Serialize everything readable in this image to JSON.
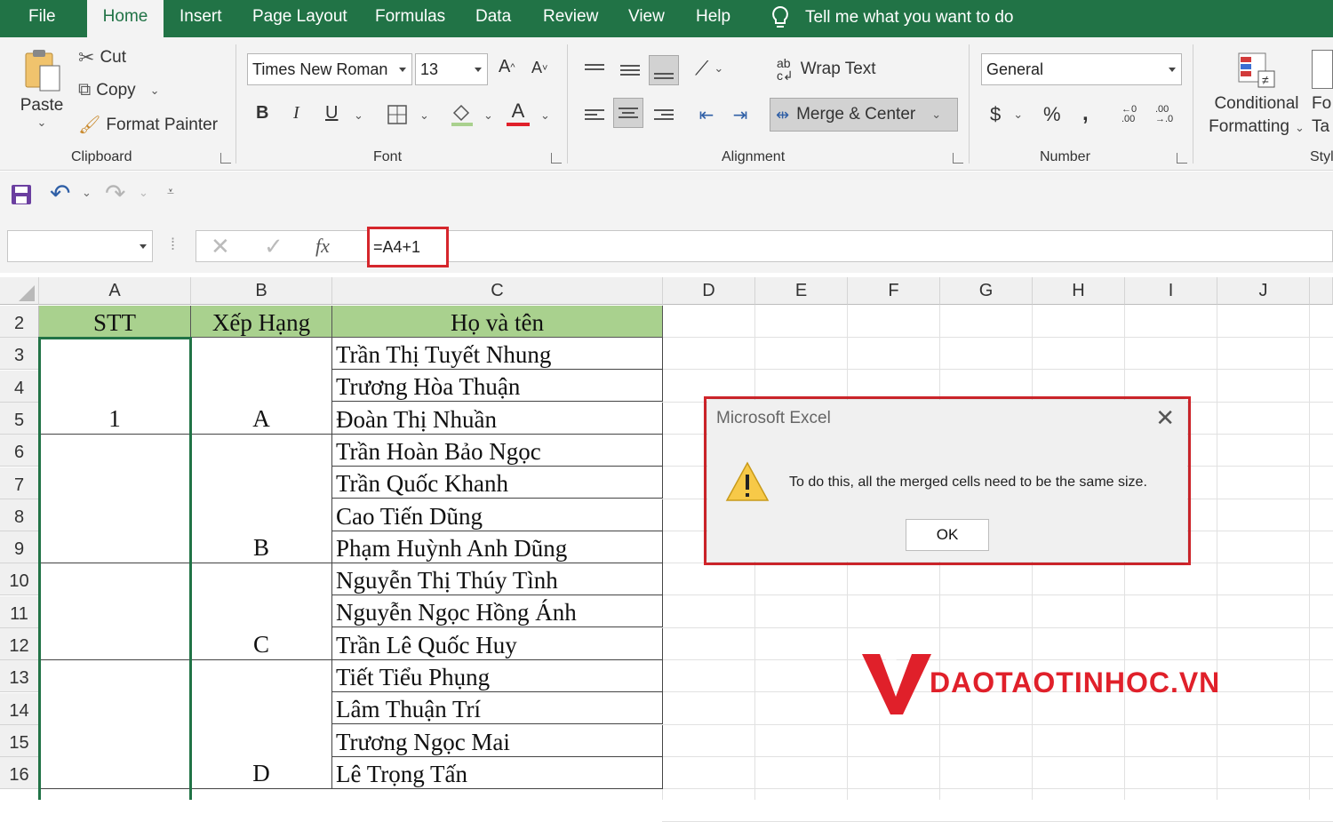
{
  "ribbon_tabs": {
    "file": "File",
    "home": "Home",
    "insert": "Insert",
    "page_layout": "Page Layout",
    "formulas": "Formulas",
    "data": "Data",
    "review": "Review",
    "view": "View",
    "help": "Help",
    "tell_me": "Tell me what you want to do"
  },
  "clipboard": {
    "paste": "Paste",
    "cut": "Cut",
    "copy": "Copy",
    "format_painter": "Format Painter",
    "label": "Clipboard"
  },
  "font": {
    "font_name": "Times New Roman",
    "font_size": "13",
    "bold": "B",
    "italic": "I",
    "underline": "U",
    "font_color_letter": "A",
    "label": "Font"
  },
  "alignment": {
    "wrap_text": "Wrap Text",
    "merge_center": "Merge & Center",
    "label": "Alignment"
  },
  "number": {
    "format": "General",
    "currency": "$",
    "percent": "%",
    "comma": ",",
    "label": "Number"
  },
  "styles": {
    "cond_line1": "Conditional",
    "cond_line2": "Formatting",
    "format_table_1": "Fo",
    "format_table_2": "Ta",
    "label": "Styl"
  },
  "formula_bar": {
    "fx": "fx",
    "formula": "=A4+1"
  },
  "columns": [
    "A",
    "B",
    "C",
    "D",
    "E",
    "F",
    "G",
    "H",
    "I",
    "J"
  ],
  "rows": [
    "2",
    "3",
    "4",
    "5",
    "6",
    "7",
    "8",
    "9",
    "10",
    "11",
    "12",
    "13",
    "14",
    "15",
    "16"
  ],
  "table": {
    "headers": [
      "STT",
      "Xếp Hạng",
      "Họ và tên"
    ],
    "stt": [
      "1",
      "",
      "",
      ""
    ],
    "ranks": [
      "A",
      "B",
      "C",
      "D"
    ],
    "names": [
      "Trần Thị Tuyết Nhung",
      "Trương Hòa Thuận",
      "Đoàn Thị Nhuần",
      "Trần Hoàn Bảo Ngọc",
      "Trần Quốc Khanh",
      "Cao Tiến Dũng",
      "Phạm Huỳnh Anh Dũng",
      "Nguyễn Thị Thúy Tình",
      "Nguyễn Ngọc Hồng Ánh",
      "Trần Lê Quốc Huy",
      "Tiết Tiểu Phụng",
      "Lâm Thuận Trí",
      "Trương Ngọc Mai",
      "Lê Trọng Tấn"
    ]
  },
  "dialog": {
    "title": "Microsoft Excel",
    "message": "To do this, all the merged cells need to be the same size.",
    "ok": "OK"
  },
  "watermark": {
    "text": "DAOTAOTINHOC.VN"
  },
  "colors": {
    "excel_green": "#217346",
    "header_fill": "#a9d18e",
    "highlight_red": "#d5262c",
    "watermark_red": "#e0202a"
  }
}
